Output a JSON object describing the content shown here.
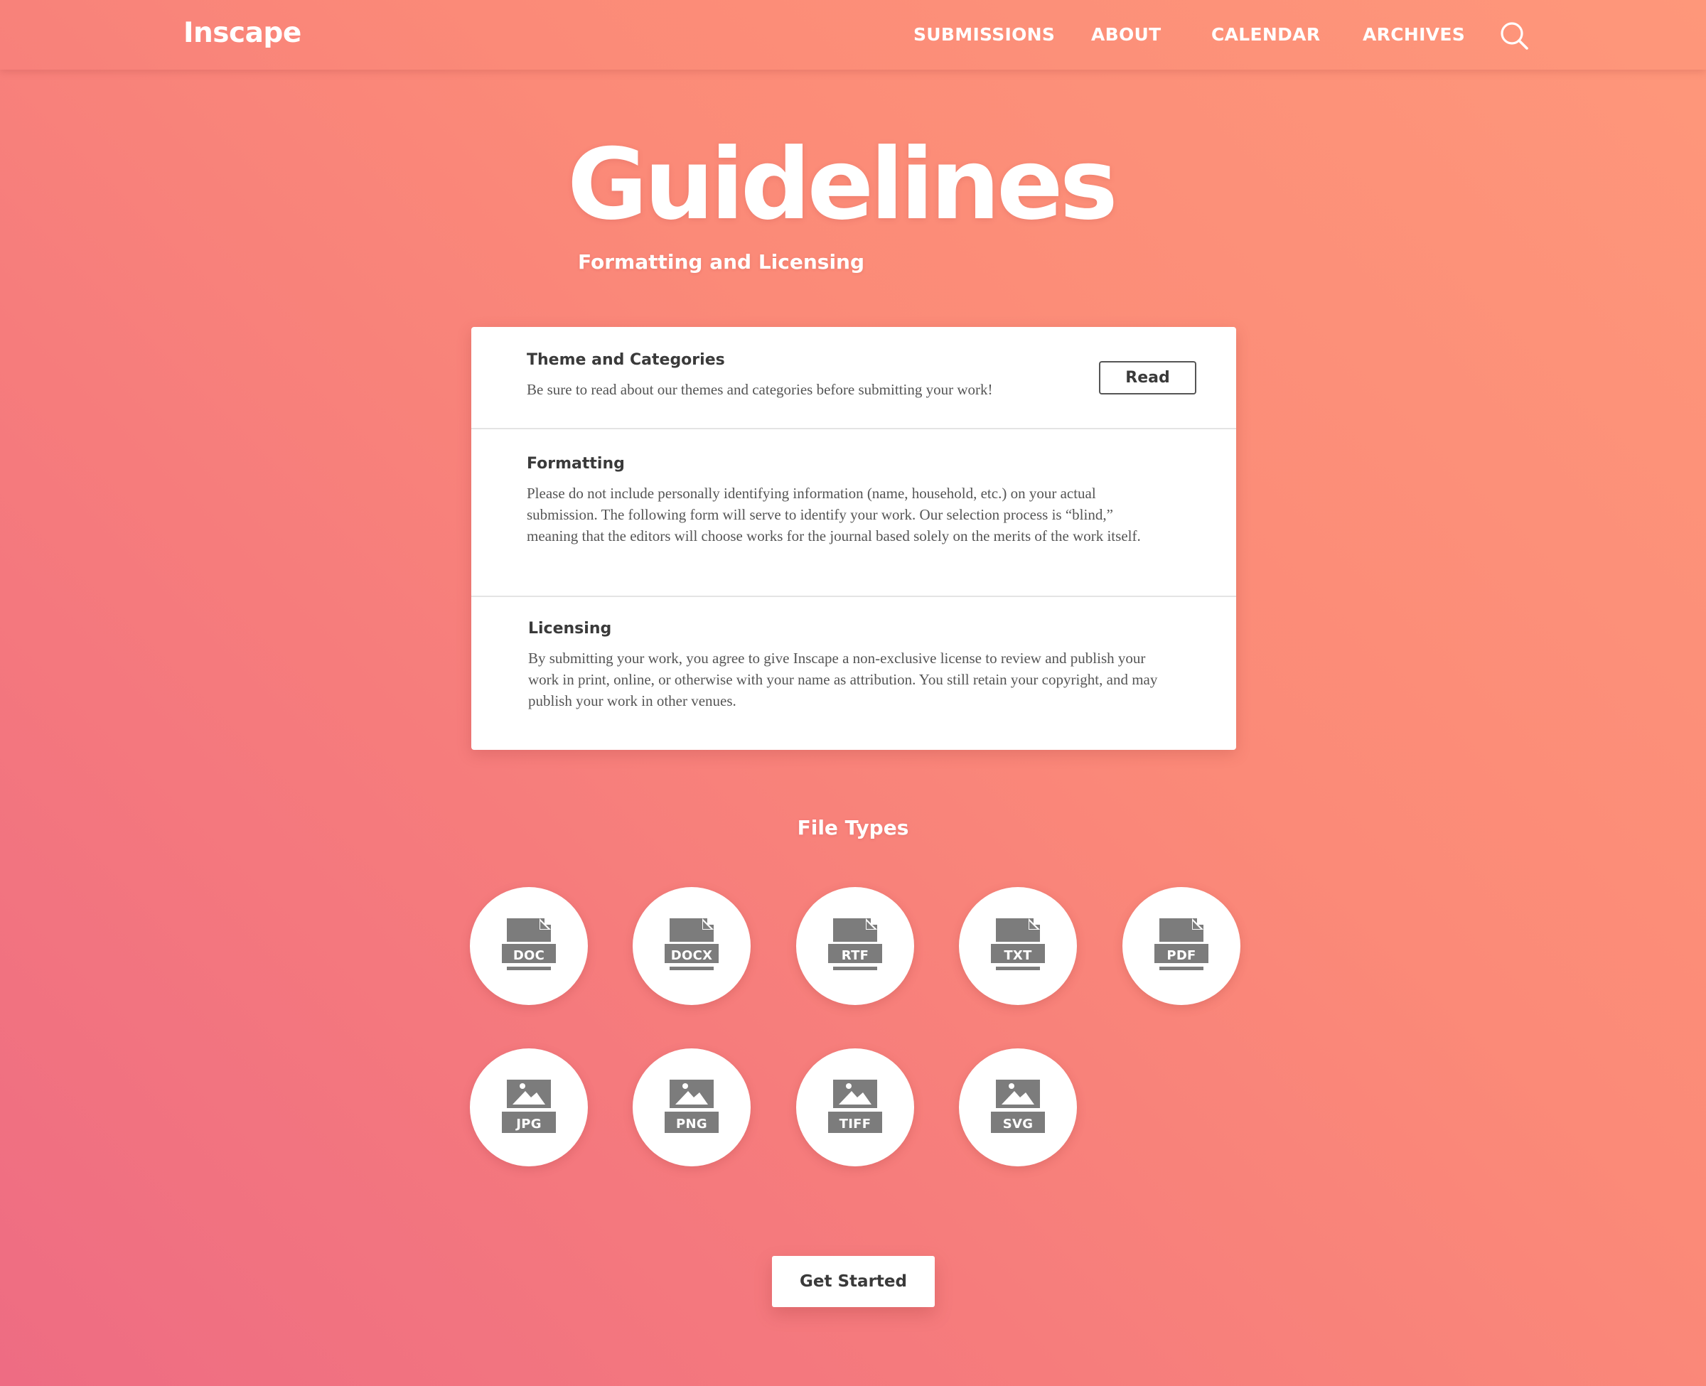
{
  "nav": {
    "brand": "Inscape",
    "links": [
      "SUBMISSIONS",
      "ABOUT",
      "CALENDAR",
      "ARCHIVES"
    ],
    "search_icon": "search-icon"
  },
  "hero": {
    "title": "Guidelines",
    "subtitle": "Formatting and Licensing"
  },
  "sections": [
    {
      "title": "Theme and Categories",
      "text": "Be sure to read about our themes and categories before submitting your work!",
      "button": "Read"
    },
    {
      "title": "Formatting",
      "text": "Please do not include personally identifying information (name, household, etc.) on your actual submission. The following form will serve to identify your work. Our selection process is “blind,” meaning that the editors will choose works for the journal based solely on the merits of the work itself."
    },
    {
      "title": "Licensing",
      "text": "By submitting your work, you agree to give Inscape a non-exclusive license to review and publish your work in print, online, or otherwise with your name as attribution.  You still retain your copyright, and may publish your work in other venues."
    }
  ],
  "file_types": {
    "heading": "File Types",
    "documents": [
      "DOC",
      "DOCX",
      "RTF",
      "TXT",
      "PDF"
    ],
    "images": [
      "JPG",
      "PNG",
      "TIFF",
      "SVG"
    ],
    "document_icon": "document-file-icon",
    "image_icon": "image-file-icon"
  },
  "cta": {
    "label": "Get Started"
  },
  "colors": {
    "gradient_start": "#fe977a",
    "gradient_end": "#ee6c83",
    "icon_gray": "#7c7c7c",
    "card_text": "#3a3a3a"
  }
}
